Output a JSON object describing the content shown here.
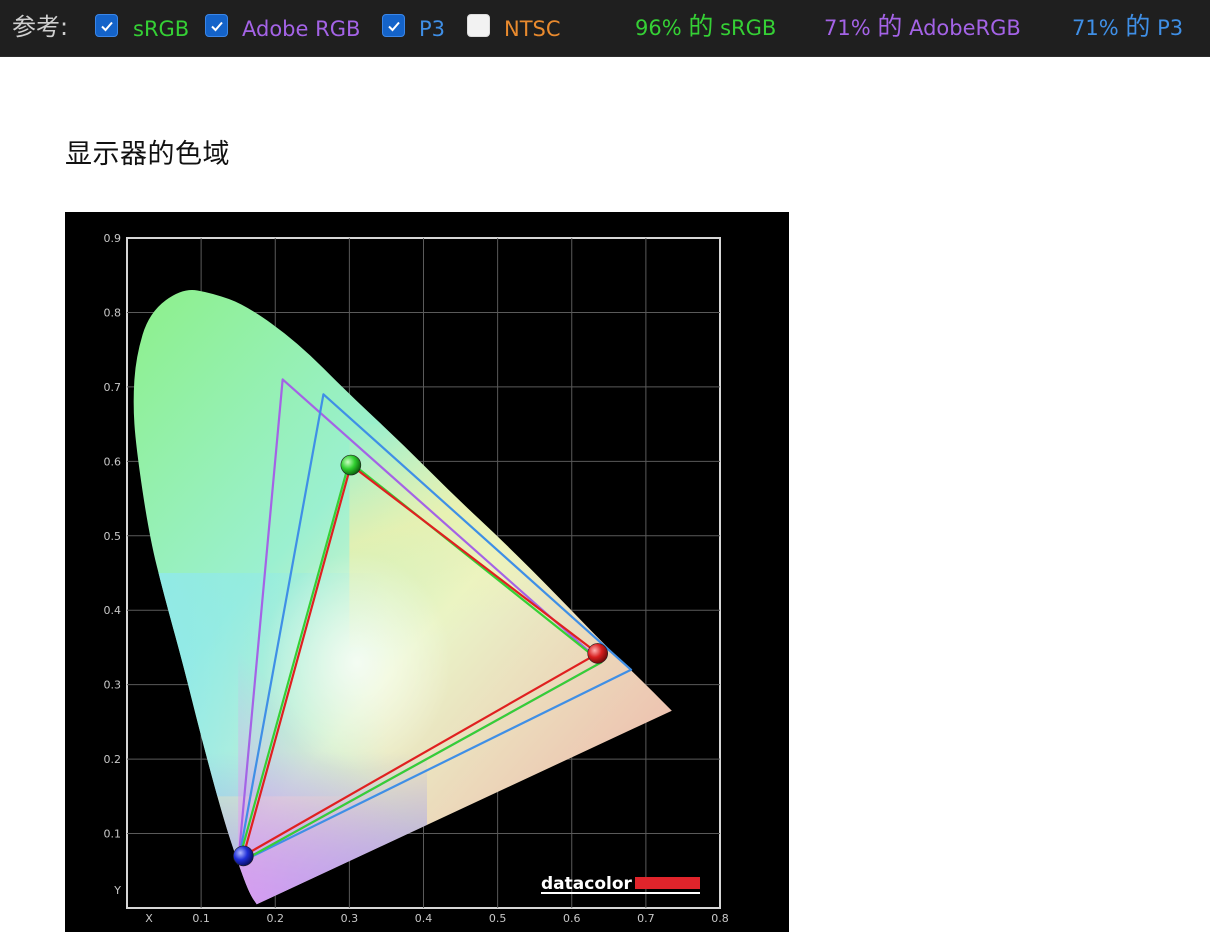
{
  "toolbar": {
    "reference_label": "参考:",
    "options": [
      {
        "id": "srgb",
        "label": "sRGB",
        "checked": true,
        "color": "#35d035"
      },
      {
        "id": "adobe",
        "label": "Adobe RGB",
        "checked": true,
        "color": "#a463e6"
      },
      {
        "id": "p3",
        "label": "P3",
        "checked": true,
        "color": "#3f8fe6"
      },
      {
        "id": "ntsc",
        "label": "NTSC",
        "checked": false,
        "color": "#e98a2e"
      }
    ],
    "coverage": [
      {
        "percent": "96%",
        "word": "的",
        "space": "sRGB",
        "color": "#35d035"
      },
      {
        "percent": "71%",
        "word": "的",
        "space": "AdobeRGB",
        "color": "#a463e6"
      },
      {
        "percent": "71%",
        "word": "的",
        "space": "P3",
        "color": "#3f8fe6"
      }
    ]
  },
  "page": {
    "title": "显示器的色域"
  },
  "chart_data": {
    "type": "scatter",
    "description_kind": "CIE 1931 xy chromaticity gamut plot",
    "xlim": [
      0.0,
      0.8
    ],
    "ylim": [
      0.0,
      0.9
    ],
    "x_ticks": [
      "X",
      "0.1",
      "0.2",
      "0.3",
      "0.4",
      "0.5",
      "0.6",
      "0.7",
      "0.8"
    ],
    "y_ticks": [
      "Y",
      "0.1",
      "0.2",
      "0.3",
      "0.4",
      "0.5",
      "0.6",
      "0.7",
      "0.8",
      "0.9"
    ],
    "grid": true,
    "brand": "datacolor",
    "spectral_locus": [
      [
        0.175,
        0.005
      ],
      [
        0.165,
        0.02
      ],
      [
        0.15,
        0.06
      ],
      [
        0.13,
        0.12
      ],
      [
        0.1,
        0.23
      ],
      [
        0.075,
        0.33
      ],
      [
        0.05,
        0.42
      ],
      [
        0.03,
        0.5
      ],
      [
        0.012,
        0.62
      ],
      [
        0.008,
        0.68
      ],
      [
        0.012,
        0.74
      ],
      [
        0.03,
        0.8
      ],
      [
        0.075,
        0.833
      ],
      [
        0.115,
        0.826
      ],
      [
        0.16,
        0.81
      ],
      [
        0.23,
        0.76
      ],
      [
        0.3,
        0.69
      ],
      [
        0.37,
        0.625
      ],
      [
        0.44,
        0.555
      ],
      [
        0.51,
        0.49
      ],
      [
        0.58,
        0.42
      ],
      [
        0.64,
        0.358
      ],
      [
        0.7,
        0.3
      ],
      [
        0.735,
        0.265
      ]
    ],
    "gamuts": [
      {
        "name": "Adobe RGB",
        "color": "#a463e6",
        "points": [
          [
            0.64,
            0.33
          ],
          [
            0.21,
            0.71
          ],
          [
            0.15,
            0.06
          ]
        ]
      },
      {
        "name": "P3",
        "color": "#3f8fe6",
        "points": [
          [
            0.68,
            0.32
          ],
          [
            0.265,
            0.69
          ],
          [
            0.15,
            0.06
          ]
        ]
      },
      {
        "name": "sRGB",
        "color": "#35d035",
        "points": [
          [
            0.64,
            0.33
          ],
          [
            0.3,
            0.6
          ],
          [
            0.15,
            0.06
          ]
        ]
      },
      {
        "name": "Display",
        "color": "#e02020",
        "points": [
          [
            0.635,
            0.342
          ],
          [
            0.302,
            0.595
          ],
          [
            0.157,
            0.07
          ]
        ]
      }
    ],
    "primaries": [
      {
        "name": "red",
        "x": 0.635,
        "y": 0.342,
        "color": "#d81f1f"
      },
      {
        "name": "green",
        "x": 0.302,
        "y": 0.595,
        "color": "#2fcf2f"
      },
      {
        "name": "blue",
        "x": 0.157,
        "y": 0.07,
        "color": "#1f2fd8"
      }
    ]
  }
}
